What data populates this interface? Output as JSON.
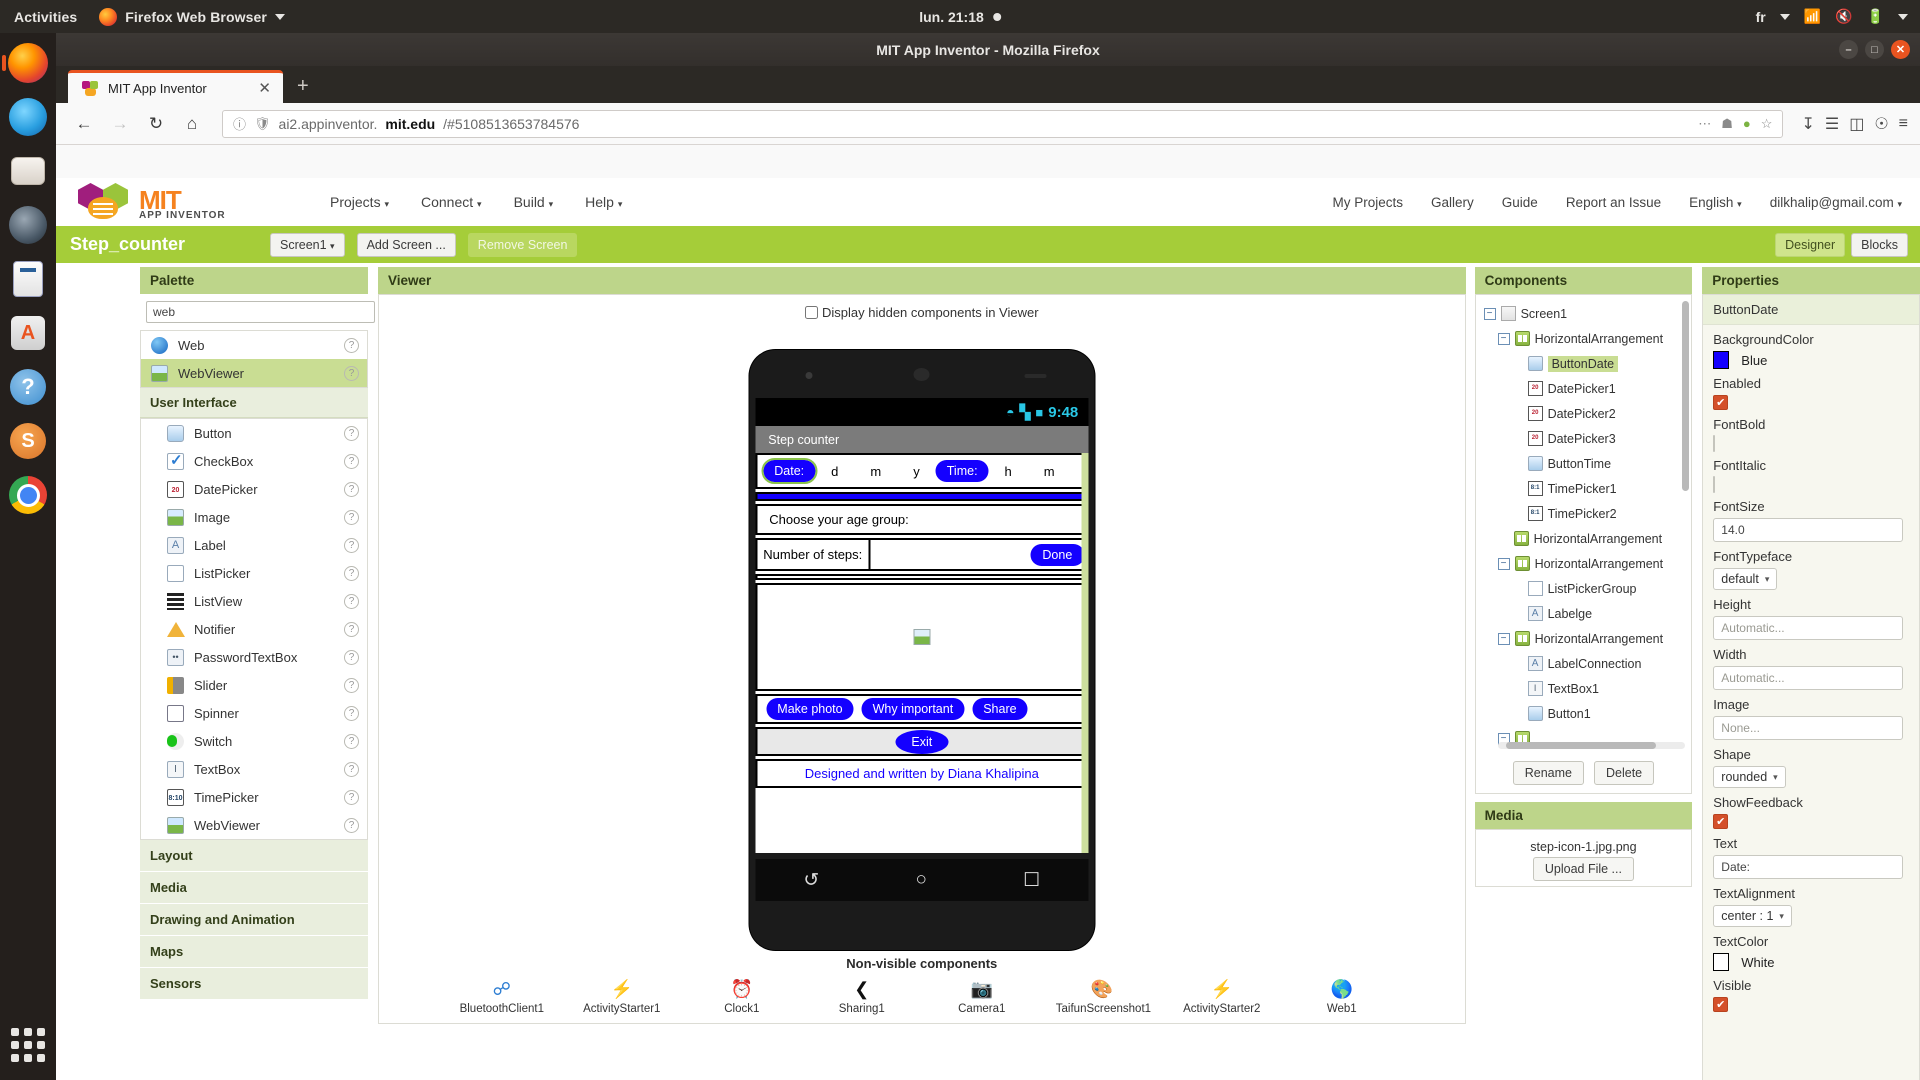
{
  "desktop": {
    "activities": "Activities",
    "app_menu": "Firefox Web Browser",
    "clock": "lun. 21:18",
    "keyboard_layout": "fr",
    "tray_icons": [
      "wifi-icon",
      "volume-muted-icon",
      "battery-charging-icon",
      "chevron-down-icon"
    ],
    "dock_items": [
      {
        "name": "firefox",
        "label": "Firefox"
      },
      {
        "name": "thunderbird",
        "label": "Thunderbird"
      },
      {
        "name": "files",
        "label": "Files"
      },
      {
        "name": "rhythmbox",
        "label": "Rhythmbox"
      },
      {
        "name": "libreoffice-writer",
        "label": "LibreOffice Writer"
      },
      {
        "name": "ubuntu-software",
        "label": "Ubuntu Software"
      },
      {
        "name": "help",
        "label": "Help"
      },
      {
        "name": "sublime-text",
        "label": "Sublime Text"
      },
      {
        "name": "chrome",
        "label": "Google Chrome"
      }
    ],
    "show_applications": "Show Applications"
  },
  "browser": {
    "window_title": "MIT App Inventor - Mozilla Firefox",
    "tab_title": "MIT App Inventor",
    "tab_close": "✕",
    "new_tab": "+",
    "url_domain": "ai2.appinventor.",
    "url_bold": "mit.edu",
    "url_rest": "/#5108513653784576",
    "nav": {
      "back": "←",
      "forward": "→",
      "reload": "↻",
      "home": "⌂"
    },
    "toolbar_right": [
      "downloads-icon",
      "library-icon",
      "sidebar-icon",
      "account-icon",
      "menu-icon"
    ],
    "window_buttons": {
      "minimize": "–",
      "maximize": "□",
      "close": "✕"
    }
  },
  "appinventor": {
    "logo_primary": "MIT",
    "logo_secondary": "APP INVENTOR",
    "menu": [
      {
        "label": "Projects",
        "caret": "▾"
      },
      {
        "label": "Connect",
        "caret": "▾"
      },
      {
        "label": "Build",
        "caret": "▾"
      },
      {
        "label": "Help",
        "caret": "▾"
      }
    ],
    "account_menu": [
      {
        "label": "My Projects",
        "caret": ""
      },
      {
        "label": "Gallery",
        "caret": ""
      },
      {
        "label": "Guide",
        "caret": ""
      },
      {
        "label": "Report an Issue",
        "caret": ""
      },
      {
        "label": "English",
        "caret": "▾"
      },
      {
        "label": "dilkhalip@gmail.com",
        "caret": "▾"
      }
    ],
    "toolbar": {
      "project_name": "Step_counter",
      "screen_select": "Screen1",
      "screen_caret": "▾",
      "add_screen": "Add Screen ...",
      "remove_screen": "Remove Screen",
      "designer": "Designer",
      "blocks": "Blocks"
    },
    "palette": {
      "title": "Palette",
      "search_value": "web",
      "search_placeholder": "",
      "results": [
        {
          "label": "Web",
          "icon": "web-icon",
          "selected": false
        },
        {
          "label": "WebViewer",
          "icon": "webviewer-icon",
          "selected": true
        }
      ],
      "groups": [
        {
          "title": "User Interface",
          "items": [
            {
              "label": "Button",
              "icon": "button-icon"
            },
            {
              "label": "CheckBox",
              "icon": "checkbox-icon"
            },
            {
              "label": "DatePicker",
              "icon": "datepicker-icon"
            },
            {
              "label": "Image",
              "icon": "image-icon"
            },
            {
              "label": "Label",
              "icon": "label-icon"
            },
            {
              "label": "ListPicker",
              "icon": "listpicker-icon"
            },
            {
              "label": "ListView",
              "icon": "listview-icon"
            },
            {
              "label": "Notifier",
              "icon": "notifier-icon"
            },
            {
              "label": "PasswordTextBox",
              "icon": "passwordtextbox-icon"
            },
            {
              "label": "Slider",
              "icon": "slider-icon"
            },
            {
              "label": "Spinner",
              "icon": "spinner-icon"
            },
            {
              "label": "Switch",
              "icon": "switch-icon"
            },
            {
              "label": "TextBox",
              "icon": "textbox-icon"
            },
            {
              "label": "TimePicker",
              "icon": "timepicker-icon"
            },
            {
              "label": "WebViewer",
              "icon": "webviewer-icon"
            }
          ]
        }
      ],
      "collapsed_categories": [
        "Layout",
        "Media",
        "Drawing and Animation",
        "Maps",
        "Sensors"
      ],
      "help_glyph": "?"
    },
    "viewer": {
      "title": "Viewer",
      "hidden_components_label": "Display hidden components in Viewer",
      "hidden_components_checked": false,
      "phone": {
        "status_time": "9:48",
        "status_icons": [
          "wifi-icon",
          "signal-icon",
          "battery-icon"
        ],
        "app_title": "Step counter",
        "row_datetime": {
          "date_button": "Date:",
          "date_parts": [
            "d",
            "m",
            "y"
          ],
          "time_button": "Time:",
          "time_parts": [
            "h",
            "m"
          ]
        },
        "age_group_label": "Choose your age group:",
        "steps_label": "Number of steps:",
        "steps_value": "",
        "done_button": "Done",
        "action_buttons": [
          "Make photo",
          "Why important",
          "Share"
        ],
        "exit_button": "Exit",
        "credit": "Designed and written by Diana Khalipina",
        "nav_bar": [
          "back-icon",
          "home-icon",
          "recents-icon"
        ]
      },
      "nonvisible_title": "Non-visible components",
      "nonvisible": [
        {
          "label": "BluetoothClient1",
          "icon": "bluetooth-icon"
        },
        {
          "label": "ActivityStarter1",
          "icon": "activitystarter-icon"
        },
        {
          "label": "Clock1",
          "icon": "clock-icon"
        },
        {
          "label": "Sharing1",
          "icon": "share-icon"
        },
        {
          "label": "Camera1",
          "icon": "camera-icon"
        },
        {
          "label": "TaifunScreenshot1",
          "icon": "taifun-icon"
        },
        {
          "label": "ActivityStarter2",
          "icon": "activitystarter-icon"
        },
        {
          "label": "Web1",
          "icon": "web-icon"
        }
      ]
    },
    "components": {
      "title": "Components",
      "tree": [
        {
          "label": "Screen1",
          "depth": 0,
          "expander": "−",
          "icon": "screen-icon",
          "selected": false
        },
        {
          "label": "HorizontalArrangement",
          "depth": 1,
          "expander": "−",
          "icon": "arrangement-icon",
          "selected": false
        },
        {
          "label": "ButtonDate",
          "depth": 2,
          "expander": "",
          "icon": "button-icon",
          "selected": true
        },
        {
          "label": "DatePicker1",
          "depth": 2,
          "expander": "",
          "icon": "datepicker-icon",
          "selected": false
        },
        {
          "label": "DatePicker2",
          "depth": 2,
          "expander": "",
          "icon": "datepicker-icon",
          "selected": false
        },
        {
          "label": "DatePicker3",
          "depth": 2,
          "expander": "",
          "icon": "datepicker-icon",
          "selected": false
        },
        {
          "label": "ButtonTime",
          "depth": 2,
          "expander": "",
          "icon": "button-icon",
          "selected": false
        },
        {
          "label": "TimePicker1",
          "depth": 2,
          "expander": "",
          "icon": "timepicker-icon",
          "selected": false
        },
        {
          "label": "TimePicker2",
          "depth": 2,
          "expander": "",
          "icon": "timepicker-icon",
          "selected": false
        },
        {
          "label": "HorizontalArrangement",
          "depth": 1,
          "expander": "",
          "icon": "arrangement-icon",
          "selected": false
        },
        {
          "label": "HorizontalArrangement",
          "depth": 1,
          "expander": "−",
          "icon": "arrangement-icon",
          "selected": false
        },
        {
          "label": "ListPickerGroup",
          "depth": 2,
          "expander": "",
          "icon": "listpicker-icon",
          "selected": false
        },
        {
          "label": "Labelge",
          "depth": 2,
          "expander": "",
          "icon": "label-icon",
          "selected": false
        },
        {
          "label": "HorizontalArrangement",
          "depth": 1,
          "expander": "−",
          "icon": "arrangement-icon",
          "selected": false
        },
        {
          "label": "LabelConnection",
          "depth": 2,
          "expander": "",
          "icon": "label-icon",
          "selected": false
        },
        {
          "label": "TextBox1",
          "depth": 2,
          "expander": "",
          "icon": "textbox-icon",
          "selected": false
        },
        {
          "label": "Button1",
          "depth": 2,
          "expander": "",
          "icon": "button-icon",
          "selected": false
        }
      ],
      "rename_button": "Rename",
      "delete_button": "Delete"
    },
    "media": {
      "title": "Media",
      "files": [
        "step-icon-1.jpg.png"
      ],
      "upload_button": "Upload File ..."
    },
    "properties": {
      "title": "Properties",
      "selected_component": "ButtonDate",
      "items": [
        {
          "name": "BackgroundColor",
          "type": "color",
          "value": "Blue",
          "swatch": "#1400ff"
        },
        {
          "name": "Enabled",
          "type": "checkbox",
          "checked": true
        },
        {
          "name": "FontBold",
          "type": "checkbox",
          "checked": false
        },
        {
          "name": "FontItalic",
          "type": "checkbox",
          "checked": false
        },
        {
          "name": "FontSize",
          "type": "text",
          "value": "14.0"
        },
        {
          "name": "FontTypeface",
          "type": "select",
          "value": "default"
        },
        {
          "name": "Height",
          "type": "text",
          "value": "Automatic...",
          "placeholder": true
        },
        {
          "name": "Width",
          "type": "text",
          "value": "Automatic...",
          "placeholder": true
        },
        {
          "name": "Image",
          "type": "text",
          "value": "None...",
          "placeholder": true
        },
        {
          "name": "Shape",
          "type": "select",
          "value": "rounded"
        },
        {
          "name": "ShowFeedback",
          "type": "checkbox",
          "checked": true
        },
        {
          "name": "Text",
          "type": "text",
          "value": "Date:"
        },
        {
          "name": "TextAlignment",
          "type": "select",
          "value": "center : 1"
        },
        {
          "name": "TextColor",
          "type": "color",
          "value": "White",
          "swatch": "#ffffff"
        },
        {
          "name": "Visible",
          "type": "checkbox",
          "checked": true
        }
      ],
      "checkbox_glyph": "✔",
      "caret": "▾"
    }
  },
  "colors": {
    "accent_green": "#a5cd39",
    "panel_head": "#bdd58a",
    "selection": "#c9dd93",
    "app_blue": "#1400ff",
    "ubuntu_orange": "#e95420"
  }
}
